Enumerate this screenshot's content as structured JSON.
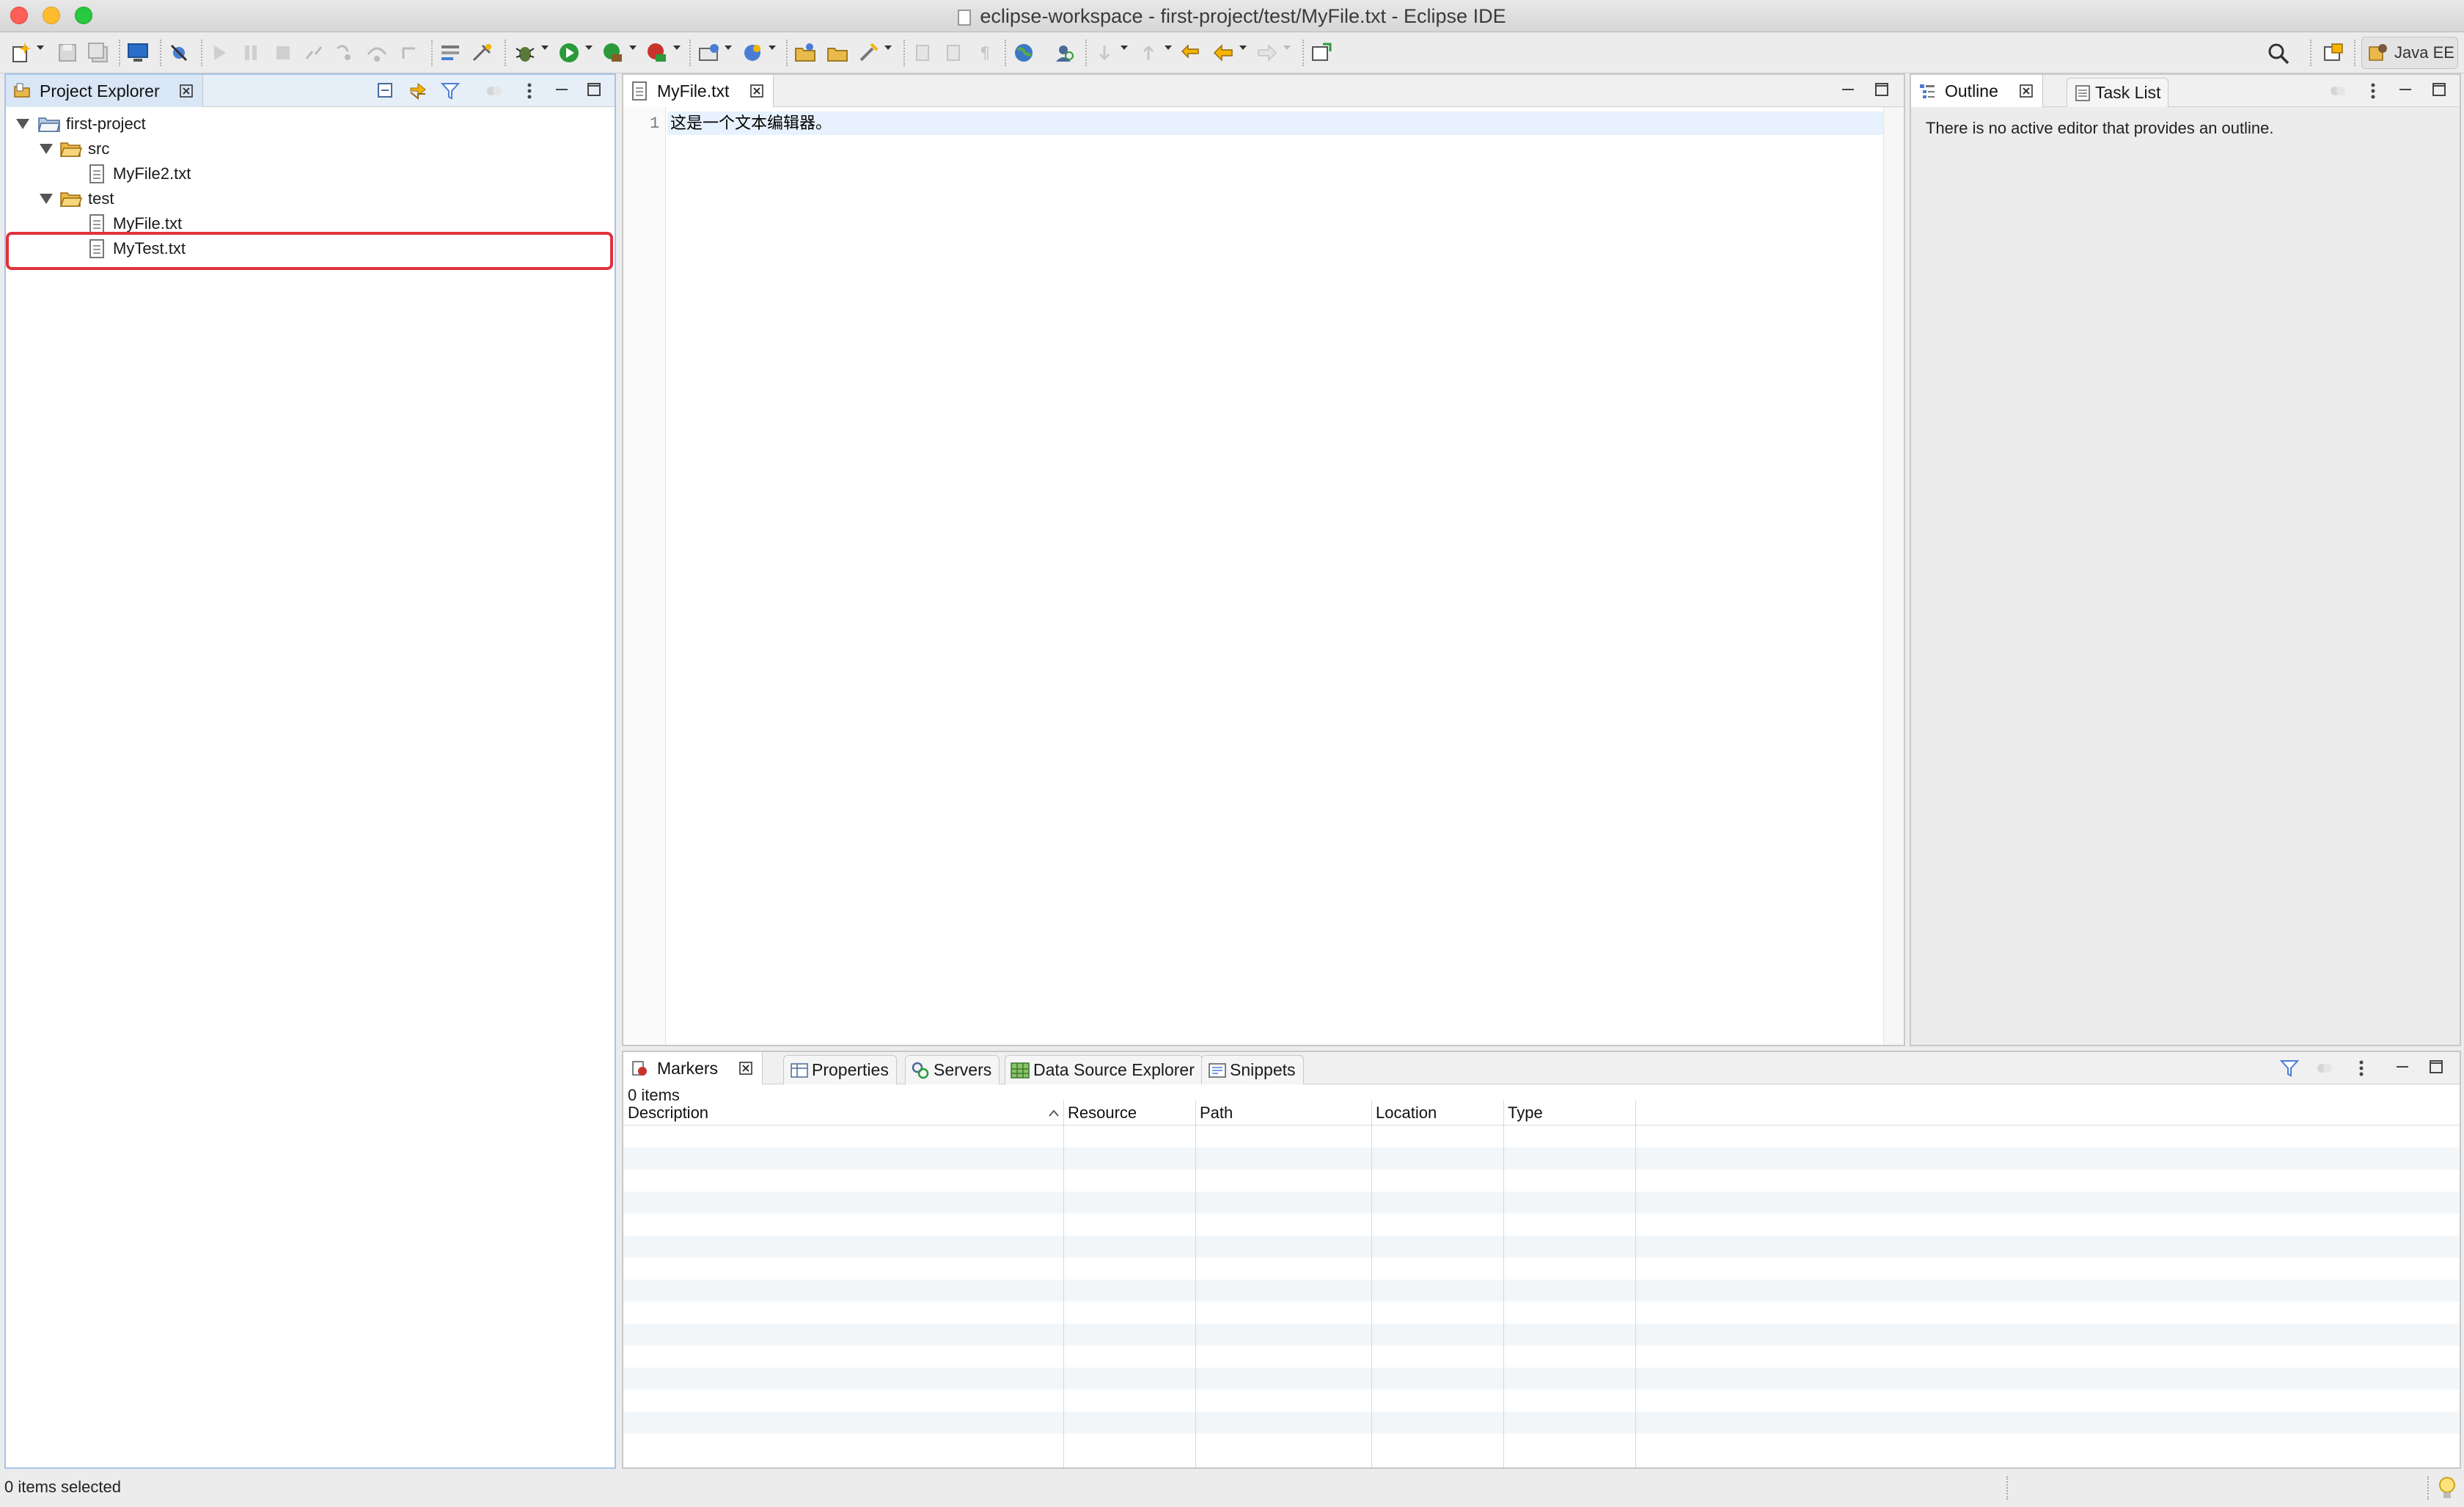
{
  "window": {
    "title": "eclipse-workspace - first-project/test/MyFile.txt - Eclipse IDE"
  },
  "toolbar": {
    "perspective_label": "Java EE"
  },
  "project_explorer": {
    "tab_label": "Project Explorer",
    "tree": [
      {
        "label": "first-project",
        "kind": "project",
        "level": 0,
        "expanded": true
      },
      {
        "label": "src",
        "kind": "folder",
        "level": 1,
        "expanded": true
      },
      {
        "label": "MyFile2.txt",
        "kind": "file",
        "level": 2
      },
      {
        "label": "test",
        "kind": "folder",
        "level": 1,
        "expanded": true
      },
      {
        "label": "MyFile.txt",
        "kind": "file",
        "level": 2
      },
      {
        "label": "MyTest.txt",
        "kind": "file",
        "level": 2,
        "highlighted": true
      }
    ]
  },
  "editor": {
    "tab_label": "MyFile.txt",
    "lines": [
      {
        "number": "1",
        "text": "这是一个文本编辑器。"
      }
    ]
  },
  "outline": {
    "tabs": [
      "Outline",
      "Task List"
    ],
    "message": "There is no active editor that provides an outline."
  },
  "bottom_panel": {
    "tabs": [
      "Markers",
      "Properties",
      "Servers",
      "Data Source Explorer",
      "Snippets"
    ],
    "count_text": "0 items",
    "columns": [
      "Description",
      "Resource",
      "Path",
      "Location",
      "Type"
    ]
  },
  "status_bar": {
    "text": "0 items selected"
  },
  "colors": {
    "highlight_border": "#e0323c",
    "selection_tab_blue": "#d9e6f5",
    "current_line": "#e8f2fe"
  }
}
